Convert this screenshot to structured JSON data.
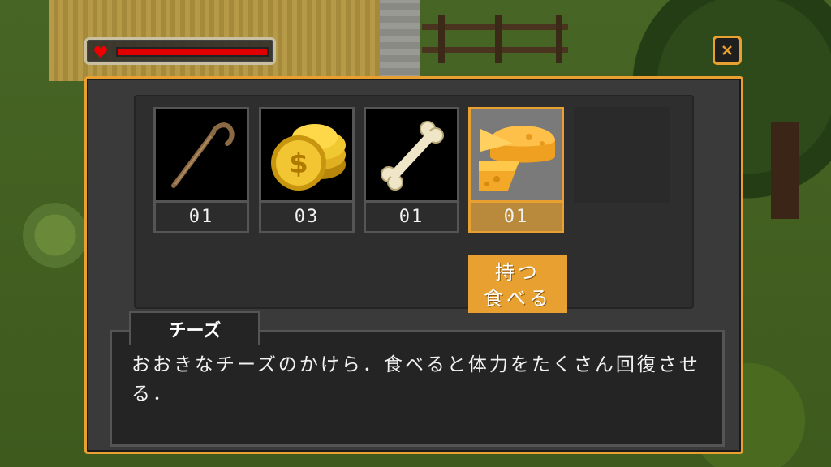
{
  "hud": {
    "hp_level": 1.0,
    "hp_color": "#e00000",
    "heart_icon": "heart-icon"
  },
  "close_button": {
    "icon": "close-icon",
    "label": "×"
  },
  "inventory": {
    "slots": [
      {
        "item": "staff",
        "icon": "staff-icon",
        "count": "01"
      },
      {
        "item": "coins",
        "icon": "coins-icon",
        "count": "03"
      },
      {
        "item": "bone",
        "icon": "bone-icon",
        "count": "01"
      },
      {
        "item": "cheese",
        "icon": "cheese-icon",
        "count": "01",
        "selected": true
      },
      {
        "item": "",
        "icon": "",
        "count": ""
      }
    ],
    "actions": [
      "持つ",
      "食べる"
    ]
  },
  "description": {
    "name": "チーズ",
    "text": "おおきなチーズのかけら．食べると体力をたくさん回復させる．"
  },
  "colors": {
    "accent": "#e8a030",
    "panel": "#3a3a3a"
  }
}
